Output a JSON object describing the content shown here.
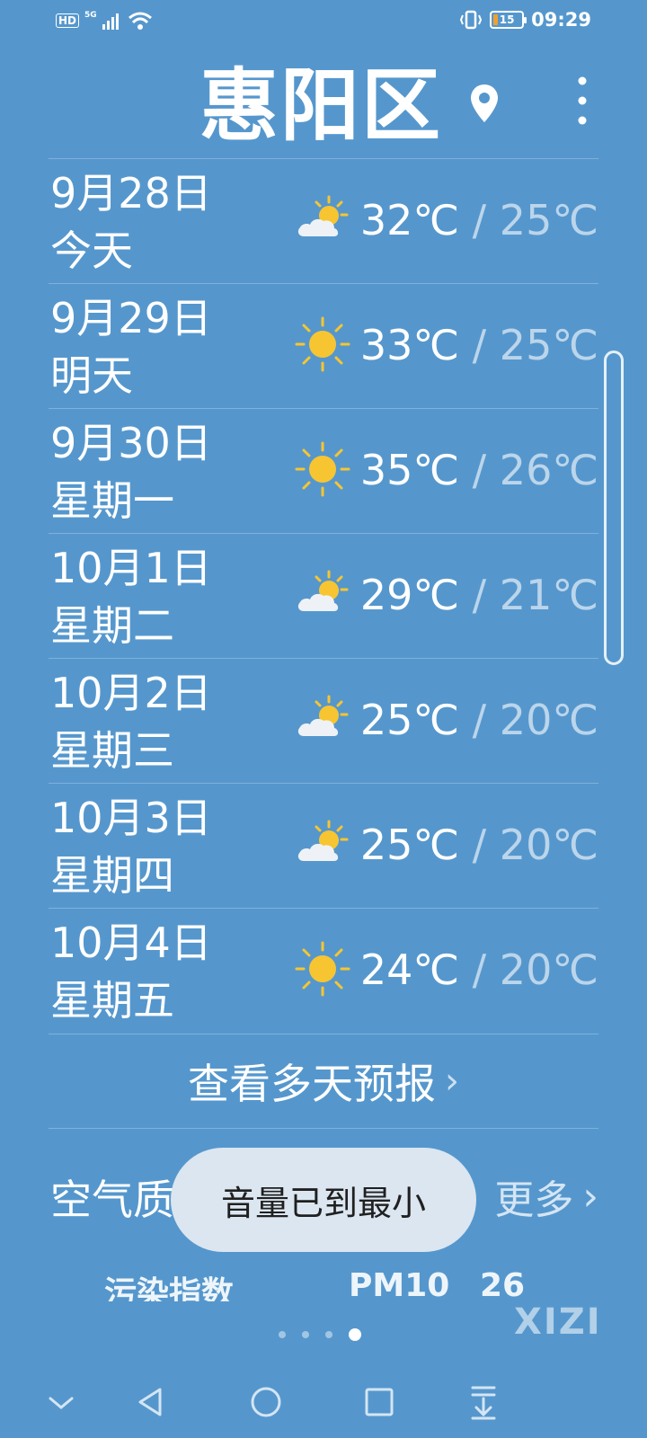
{
  "status_bar": {
    "hd": "HD",
    "network": "5G",
    "battery": "15",
    "time": "09:29"
  },
  "header": {
    "city": "惠阳区",
    "location_icon": "location-pin-icon",
    "menu_icon": "more-vertical-icon"
  },
  "forecast": [
    {
      "date": "9月28日",
      "day": "今天",
      "icon": "partly-cloudy",
      "high": "32℃",
      "low": "25℃"
    },
    {
      "date": "9月29日",
      "day": "明天",
      "icon": "sunny",
      "high": "33℃",
      "low": "25℃"
    },
    {
      "date": "9月30日",
      "day": "星期一",
      "icon": "sunny",
      "high": "35℃",
      "low": "26℃"
    },
    {
      "date": "10月1日",
      "day": "星期二",
      "icon": "partly-cloudy",
      "high": "29℃",
      "low": "21℃"
    },
    {
      "date": "10月2日",
      "day": "星期三",
      "icon": "partly-cloudy",
      "high": "25℃",
      "low": "20℃"
    },
    {
      "date": "10月3日",
      "day": "星期四",
      "icon": "partly-cloudy",
      "high": "25℃",
      "low": "20℃"
    },
    {
      "date": "10月4日",
      "day": "星期五",
      "icon": "sunny",
      "high": "24℃",
      "low": "20℃"
    }
  ],
  "more_forecast": "查看多天预报",
  "air_quality": {
    "title": "空气质量",
    "more": "更多",
    "pollution_index": "污染指数",
    "pm10_label": "PM10",
    "pm10_value": "26"
  },
  "toast": "音量已到最小",
  "watermark": "XIZI",
  "colors": {
    "background": "#5597cd",
    "sun": "#f7c531",
    "toast_bg": "#dbe6f0"
  }
}
